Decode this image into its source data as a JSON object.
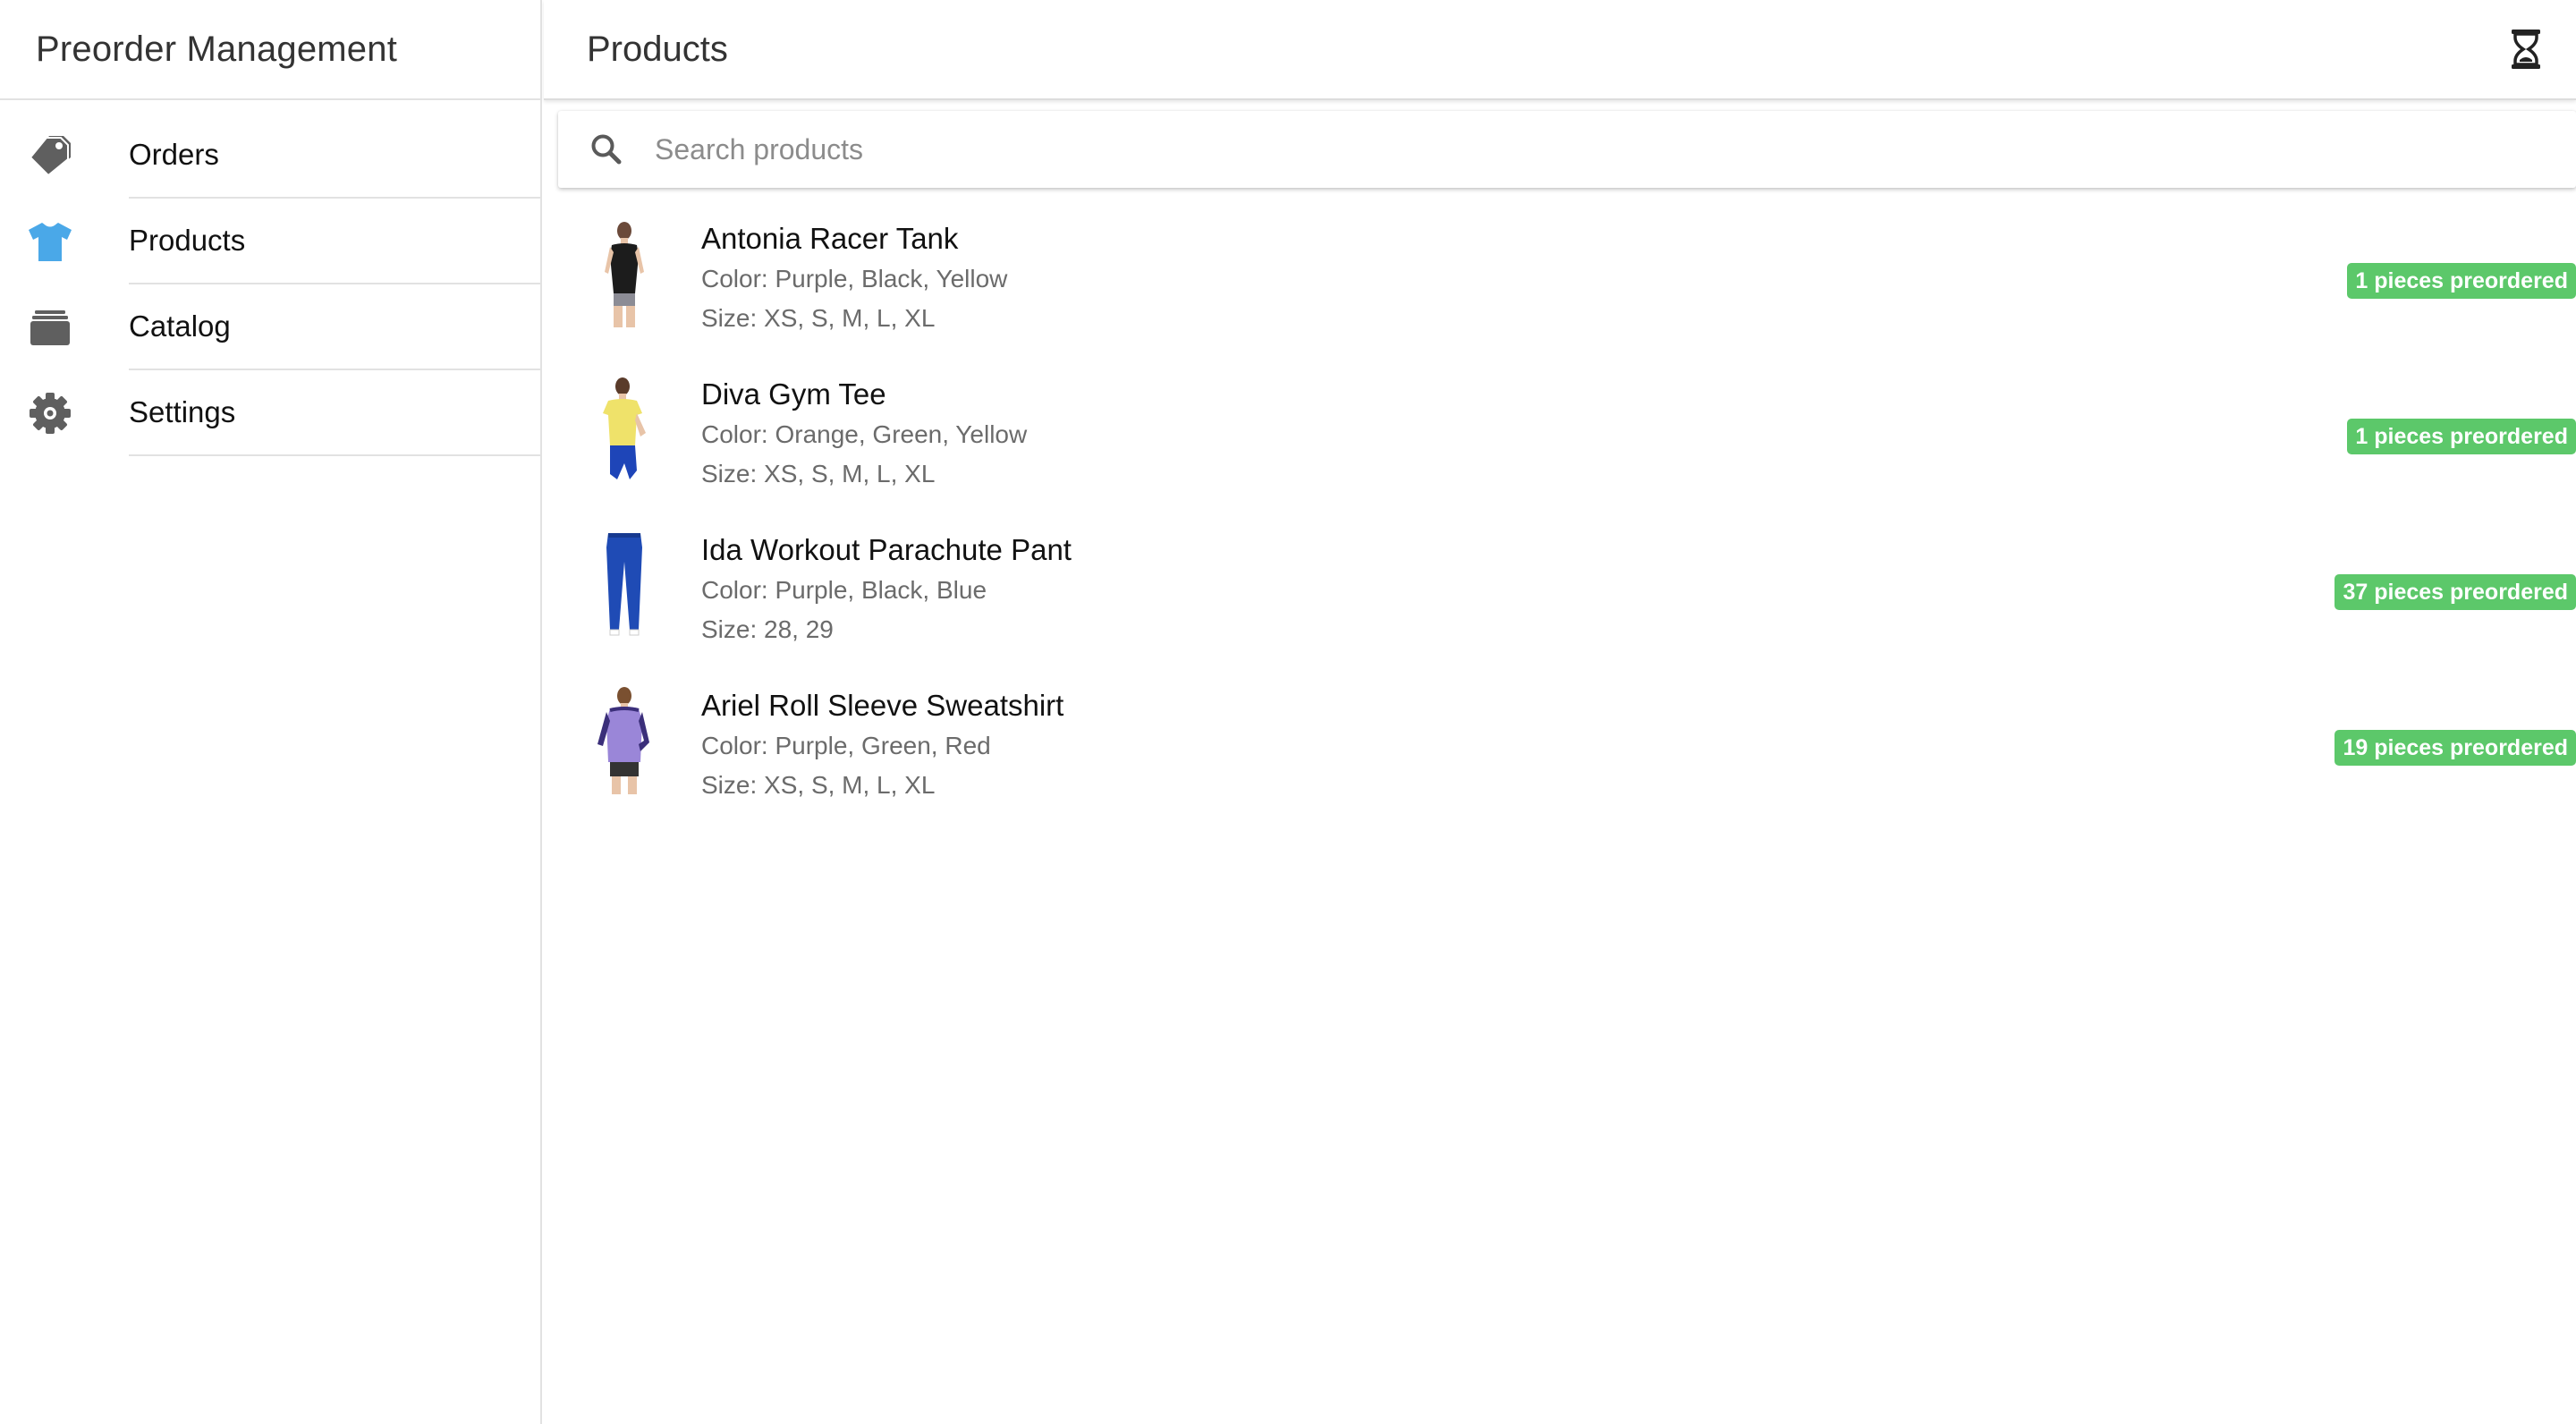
{
  "app": {
    "title": "Preorder Management"
  },
  "sidebar": {
    "items": [
      {
        "label": "Orders",
        "icon": "tag-icon",
        "active": false
      },
      {
        "label": "Products",
        "icon": "tshirt-icon",
        "active": true
      },
      {
        "label": "Catalog",
        "icon": "catalog-stack-icon",
        "active": false
      },
      {
        "label": "Settings",
        "icon": "gear-icon",
        "active": false
      }
    ]
  },
  "header": {
    "title": "Products",
    "action_icon": "hourglass-icon"
  },
  "search": {
    "placeholder": "Search products",
    "value": ""
  },
  "products": [
    {
      "name": "Antonia Racer Tank",
      "color": "Color: Purple, Black, Yellow",
      "size": "Size: XS, S, M, L, XL",
      "badge": "1 pieces preordered",
      "thumb": "black tank top"
    },
    {
      "name": "Diva Gym Tee",
      "color": "Color: Orange, Green, Yellow",
      "size": "Size: XS, S, M, L, XL",
      "badge": "1 pieces preordered",
      "thumb": "yellow tee"
    },
    {
      "name": "Ida Workout Parachute Pant",
      "color": "Color: Purple, Black, Blue",
      "size": "Size: 28, 29",
      "badge": "37 pieces preordered",
      "thumb": "blue pants"
    },
    {
      "name": "Ariel Roll Sleeve Sweatshirt",
      "color": "Color: Purple, Green, Red",
      "size": "Size: XS, S, M, L, XL",
      "badge": "19 pieces preordered",
      "thumb": "purple sweatshirt"
    }
  ],
  "colors": {
    "accent": "#4aa8e8",
    "icon_gray": "#5f5f5f",
    "badge_green": "#5cc86a",
    "divider": "#e2e2e2"
  }
}
